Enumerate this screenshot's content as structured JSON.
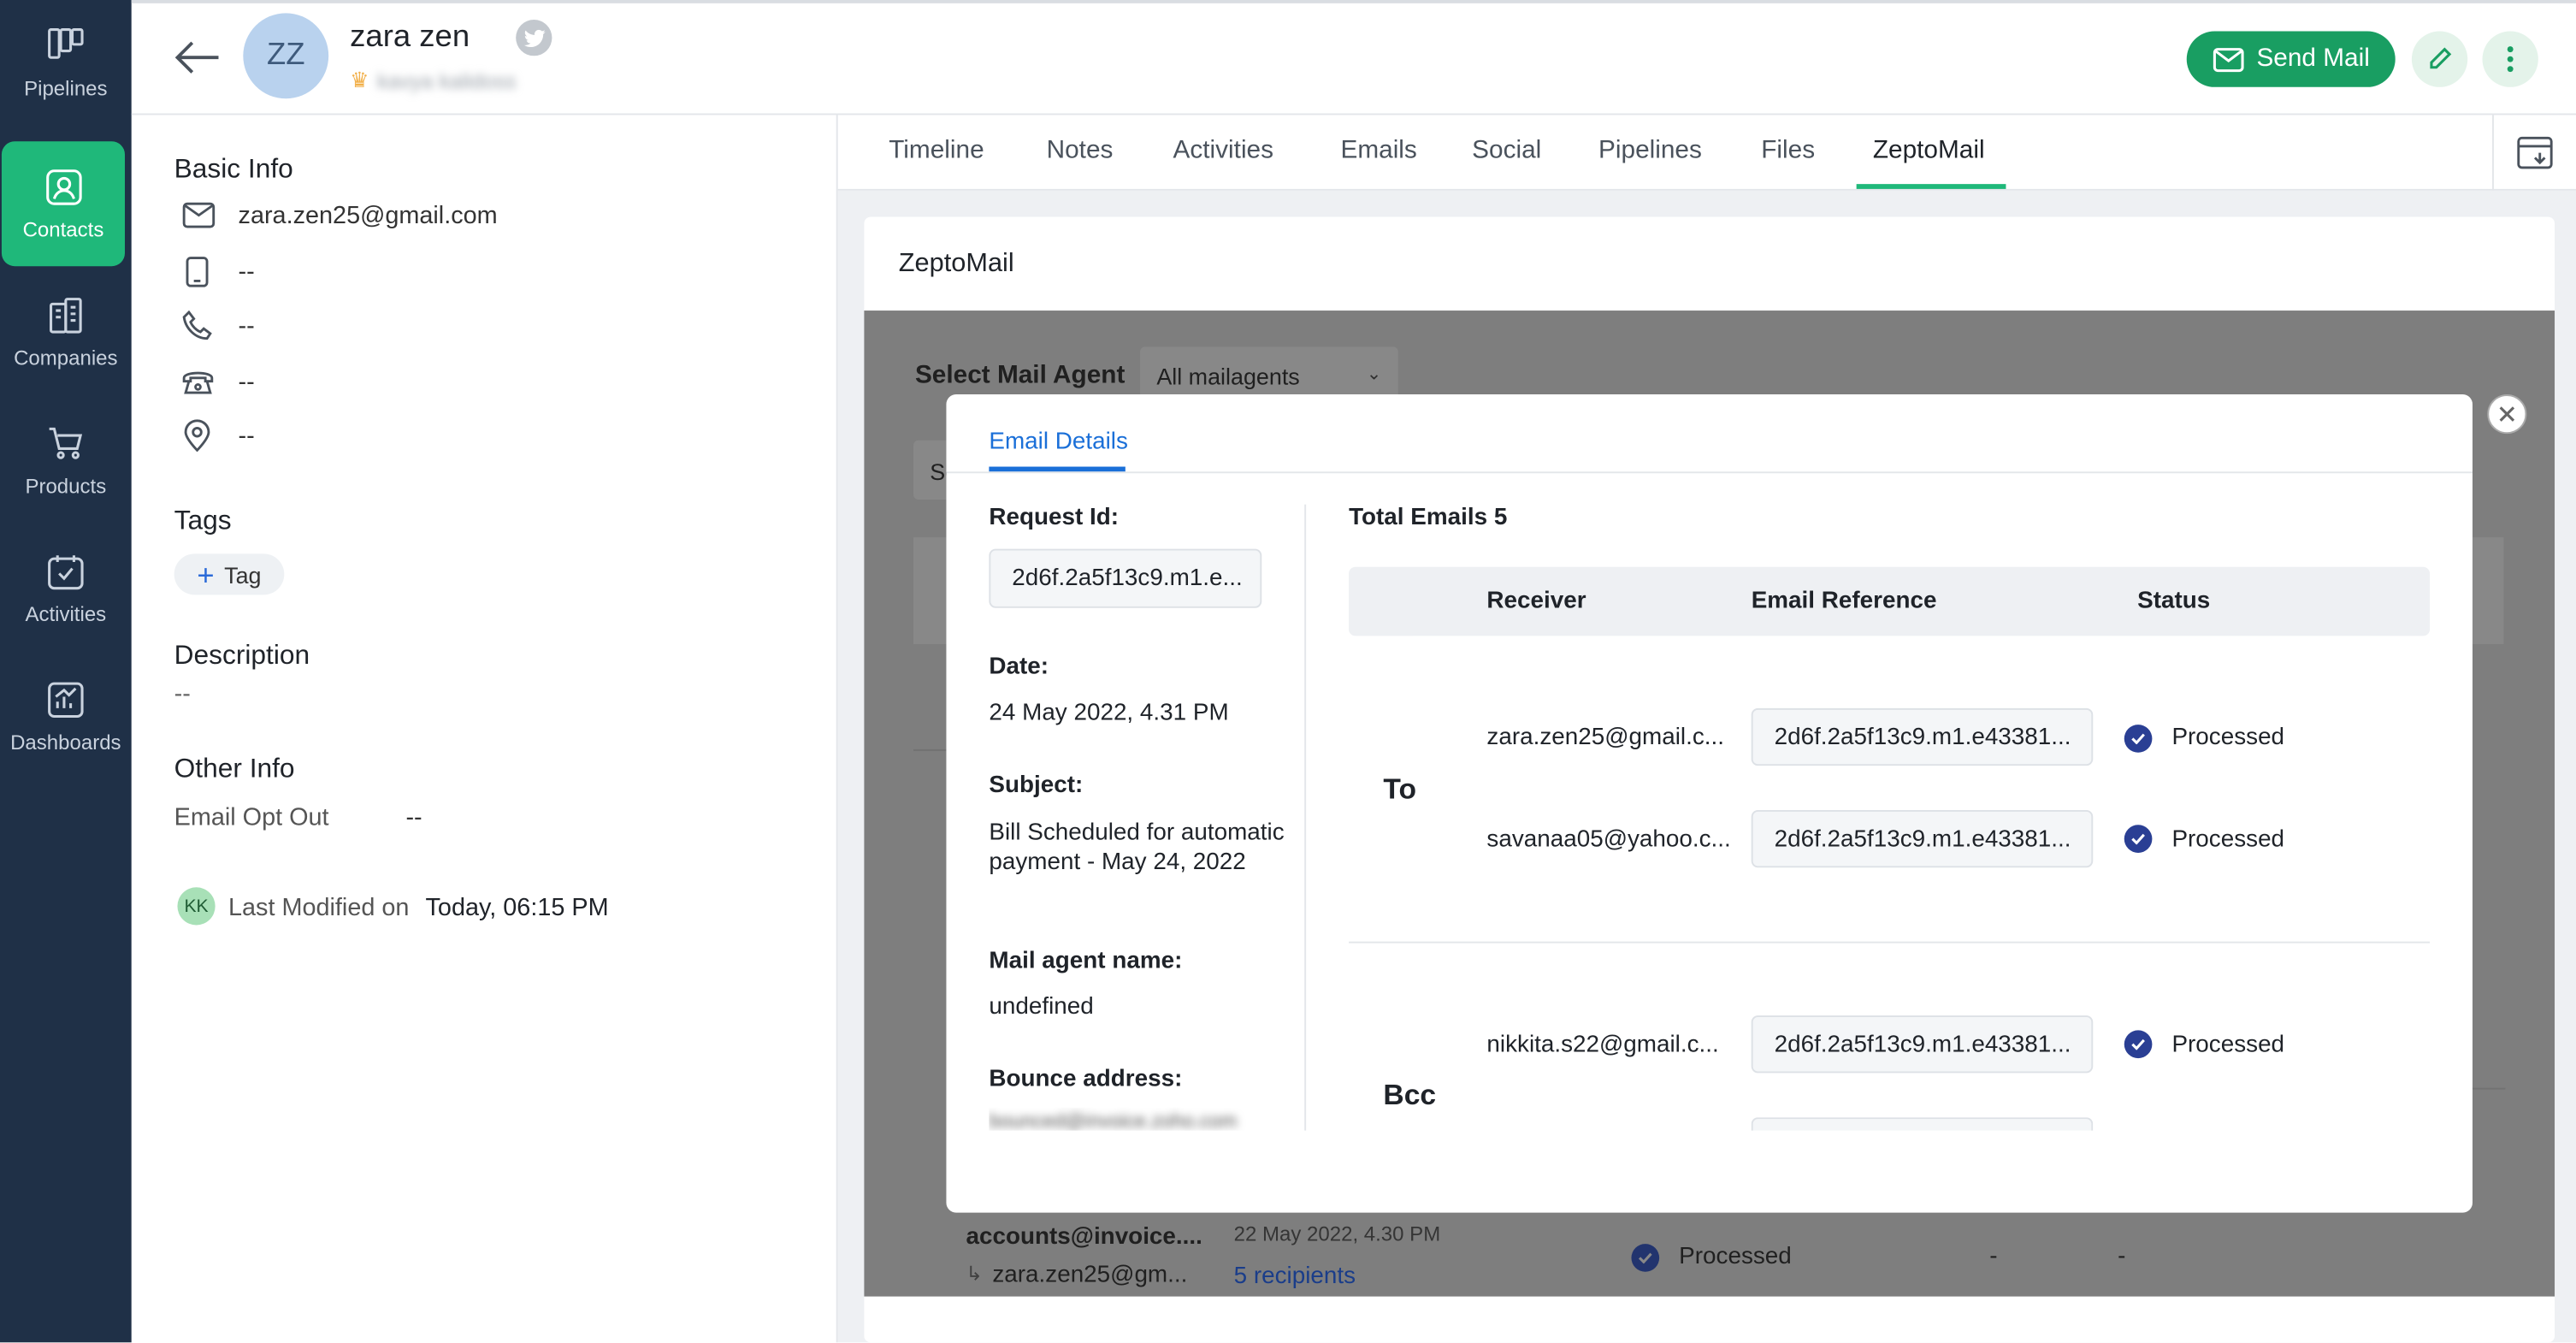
{
  "sidebar": {
    "items": [
      {
        "label": "Pipelines",
        "icon": "pipelines-icon"
      },
      {
        "label": "Contacts",
        "icon": "contacts-icon"
      },
      {
        "label": "Companies",
        "icon": "companies-icon"
      },
      {
        "label": "Products",
        "icon": "products-icon"
      },
      {
        "label": "Activities",
        "icon": "activities-icon"
      },
      {
        "label": "Dashboards",
        "icon": "dashboards-icon"
      }
    ],
    "active": "Contacts"
  },
  "header": {
    "avatar_initials": "ZZ",
    "name": "zara zen",
    "owner": "kavya kalidoss",
    "send_mail": "Send Mail"
  },
  "basic_info": {
    "title": "Basic Info",
    "email": "zara.zen25@gmail.com",
    "mobile": "--",
    "phone": "--",
    "work_phone": "--",
    "address": "--"
  },
  "tags": {
    "title": "Tags",
    "add_label": "Tag"
  },
  "description": {
    "title": "Description",
    "value": "--"
  },
  "other_info": {
    "title": "Other Info",
    "label": "Email Opt Out",
    "value": "--"
  },
  "last_modified": {
    "initials": "KK",
    "label": "Last Modified on",
    "value": "Today, 06:15 PM"
  },
  "tabs": [
    "Timeline",
    "Notes",
    "Activities",
    "Emails",
    "Social",
    "Pipelines",
    "Files",
    "ZeptoMail"
  ],
  "active_tab": "ZeptoMail",
  "zeptomail": {
    "title": "ZeptoMail",
    "select_label": "Select Mail Agent",
    "select_value": "All mailagents",
    "search_partial": "Se",
    "bg_row": {
      "sender": "accounts@invoice....",
      "recipient": "zara.zen25@gm...",
      "date": "22 May 2022, 4.30 PM",
      "recipients_link": "5 recipients",
      "status": "Processed",
      "col4": "-",
      "col5": "-"
    }
  },
  "modal": {
    "tab": "Email Details",
    "request_id_label": "Request Id:",
    "request_id": "2d6f.2a5f13c9.m1.e...",
    "date_label": "Date:",
    "date": "24 May 2022, 4.31 PM",
    "subject_label": "Subject:",
    "subject": "Bill Scheduled for automatic payment - May 24, 2022",
    "agent_label": "Mail agent name:",
    "agent": "undefined",
    "bounce_label": "Bounce address:",
    "bounce": "bounced@invoice.zoho.com",
    "total": "Total Emails 5",
    "columns": [
      "Receiver",
      "Email Reference",
      "Status"
    ],
    "to_label": "To",
    "bcc_label": "Bcc",
    "rows": [
      {
        "receiver": "zara.zen25@gmail.c...",
        "ref": "2d6f.2a5f13c9.m1.e43381...",
        "status": "Processed"
      },
      {
        "receiver": "savanaa05@yahoo.c...",
        "ref": "2d6f.2a5f13c9.m1.e43381...",
        "status": "Processed"
      },
      {
        "receiver": "nikkita.s22@gmail.c...",
        "ref": "2d6f.2a5f13c9.m1.e43381...",
        "status": "Processed"
      }
    ]
  }
}
